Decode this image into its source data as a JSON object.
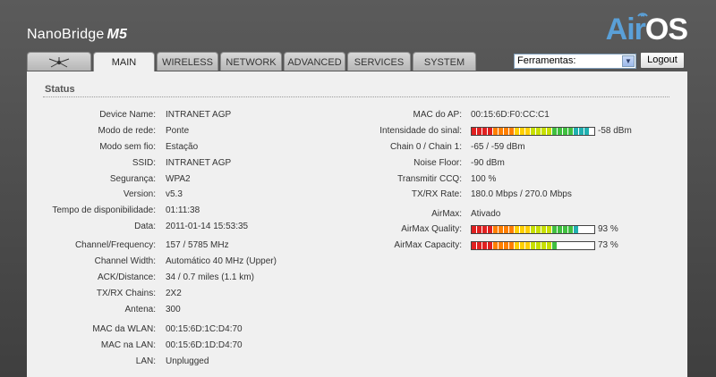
{
  "header": {
    "brand": "NanoBridge",
    "model": "M5",
    "logo_air": "Air",
    "logo_os": "OS"
  },
  "tabs": [
    {
      "label": "",
      "icon": "ubiquiti-logo-icon"
    },
    {
      "label": "MAIN"
    },
    {
      "label": "WIRELESS"
    },
    {
      "label": "NETWORK"
    },
    {
      "label": "ADVANCED"
    },
    {
      "label": "SERVICES"
    },
    {
      "label": "SYSTEM"
    }
  ],
  "tools": {
    "select_value": "Ferramentas:",
    "logout": "Logout"
  },
  "status": {
    "title": "Status",
    "left": [
      {
        "label": "Device Name:",
        "value": "INTRANET AGP"
      },
      {
        "label": "Modo de rede:",
        "value": "Ponte"
      },
      {
        "label": "Modo sem fio:",
        "value": "Estação"
      },
      {
        "label": "SSID:",
        "value": "INTRANET AGP"
      },
      {
        "label": "Segurança:",
        "value": "WPA2"
      },
      {
        "label": "Version:",
        "value": "v5.3"
      },
      {
        "label": "Tempo de disponibilidade:",
        "value": "01:11:38"
      },
      {
        "label": "Data:",
        "value": "2011-01-14 15:53:35"
      },
      {
        "label": "Channel/Frequency:",
        "value": "157 / 5785 MHz"
      },
      {
        "label": "Channel Width:",
        "value": "Automático 40 MHz (Upper)"
      },
      {
        "label": "ACK/Distance:",
        "value": "34 / 0.7 miles (1.1 km)"
      },
      {
        "label": "TX/RX Chains:",
        "value": "2X2"
      },
      {
        "label": "Antena:",
        "value": "300"
      },
      {
        "label": "MAC da WLAN:",
        "value": "00:15:6D:1C:D4:70"
      },
      {
        "label": "MAC na LAN:",
        "value": "00:15:6D:1D:D4:70"
      },
      {
        "label": "LAN:",
        "value": "Unplugged"
      }
    ],
    "right": {
      "mac_ap": {
        "label": "MAC do AP:",
        "value": "00:15:6D:F0:CC:C1"
      },
      "signal": {
        "label": "Intensidade do sinal:",
        "value": "-58 dBm",
        "level": 1.0
      },
      "chains": {
        "label": "Chain 0 / Chain 1:",
        "value": "-65 / -59 dBm"
      },
      "noise": {
        "label": "Noise Floor:",
        "value": "-90 dBm"
      },
      "ccq": {
        "label": "Transmitir CCQ:",
        "value": "100 %"
      },
      "rate": {
        "label": "TX/RX Rate:",
        "value": "180.0 Mbps / 270.0 Mbps"
      },
      "airmax": {
        "label": "AirMax:",
        "value": "Ativado"
      },
      "quality": {
        "label": "AirMax Quality:",
        "value": "93 %",
        "level": 0.93
      },
      "capacity": {
        "label": "AirMax Capacity:",
        "value": "73 %",
        "level": 0.73
      }
    }
  },
  "colors": {
    "bar_gradient": [
      "#e02020",
      "#ff7f00",
      "#ffd000",
      "#c8e000",
      "#40c040",
      "#20b0b0",
      "#2090d0"
    ]
  }
}
